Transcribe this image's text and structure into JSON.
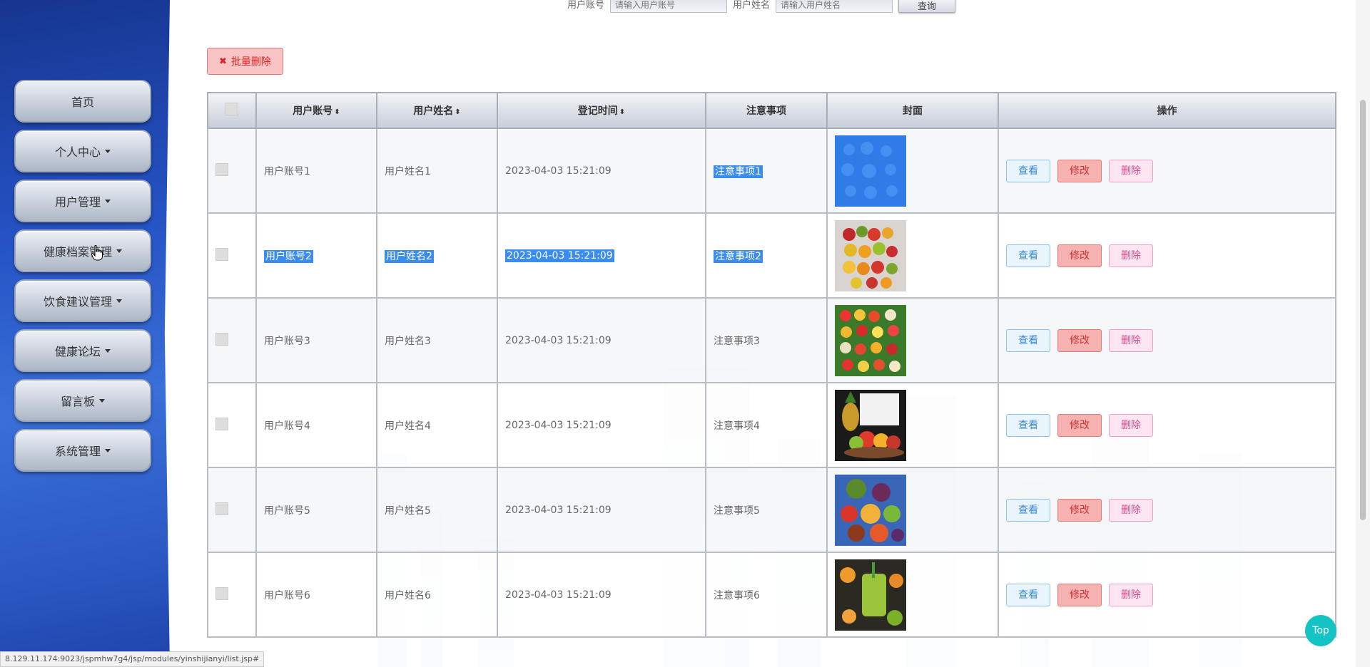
{
  "sidebar": {
    "items": [
      {
        "label": "首页",
        "dropdown": false
      },
      {
        "label": "个人中心",
        "dropdown": true
      },
      {
        "label": "用户管理",
        "dropdown": true
      },
      {
        "label": "健康档案管理",
        "dropdown": true
      },
      {
        "label": "饮食建议管理",
        "dropdown": true
      },
      {
        "label": "健康论坛",
        "dropdown": true
      },
      {
        "label": "留言板",
        "dropdown": true
      },
      {
        "label": "系统管理",
        "dropdown": true
      }
    ]
  },
  "search": {
    "account_label": "用户账号",
    "account_placeholder": "请输入用户账号",
    "name_label": "用户姓名",
    "name_placeholder": "请输入用户姓名",
    "button_label": "查询"
  },
  "toolbar": {
    "batch_delete_label": "批量删除"
  },
  "table": {
    "headers": {
      "account": "用户账号",
      "name": "用户姓名",
      "time": "登记时间",
      "notes": "注意事项",
      "cover": "封面",
      "actions": "操作"
    },
    "sort_icon": "⬍",
    "rows": [
      {
        "account": "用户账号1",
        "name": "用户姓名1",
        "time": "2023-04-03 15:21:09",
        "notes": "注意事项1"
      },
      {
        "account": "用户账号2",
        "name": "用户姓名2",
        "time": "2023-04-03 15:21:09",
        "notes": "注意事项2"
      },
      {
        "account": "用户账号3",
        "name": "用户姓名3",
        "time": "2023-04-03 15:21:09",
        "notes": "注意事项3"
      },
      {
        "account": "用户账号4",
        "name": "用户姓名4",
        "time": "2023-04-03 15:21:09",
        "notes": "注意事项4"
      },
      {
        "account": "用户账号5",
        "name": "用户姓名5",
        "time": "2023-04-03 15:21:09",
        "notes": "注意事项5"
      },
      {
        "account": "用户账号6",
        "name": "用户姓名6",
        "time": "2023-04-03 15:21:09",
        "notes": "注意事项6"
      }
    ],
    "actions": {
      "view": "查看",
      "edit": "修改",
      "delete": "删除"
    }
  },
  "status_url": "8.129.11.174:9023/jspmhw7g4/jsp/modules/yinshijianyi/list.jsp#",
  "top_button": "Top",
  "colors": {
    "sidebar": "#2553c4",
    "selection": "#3b8cf0",
    "top_button": "#14c4c4"
  }
}
